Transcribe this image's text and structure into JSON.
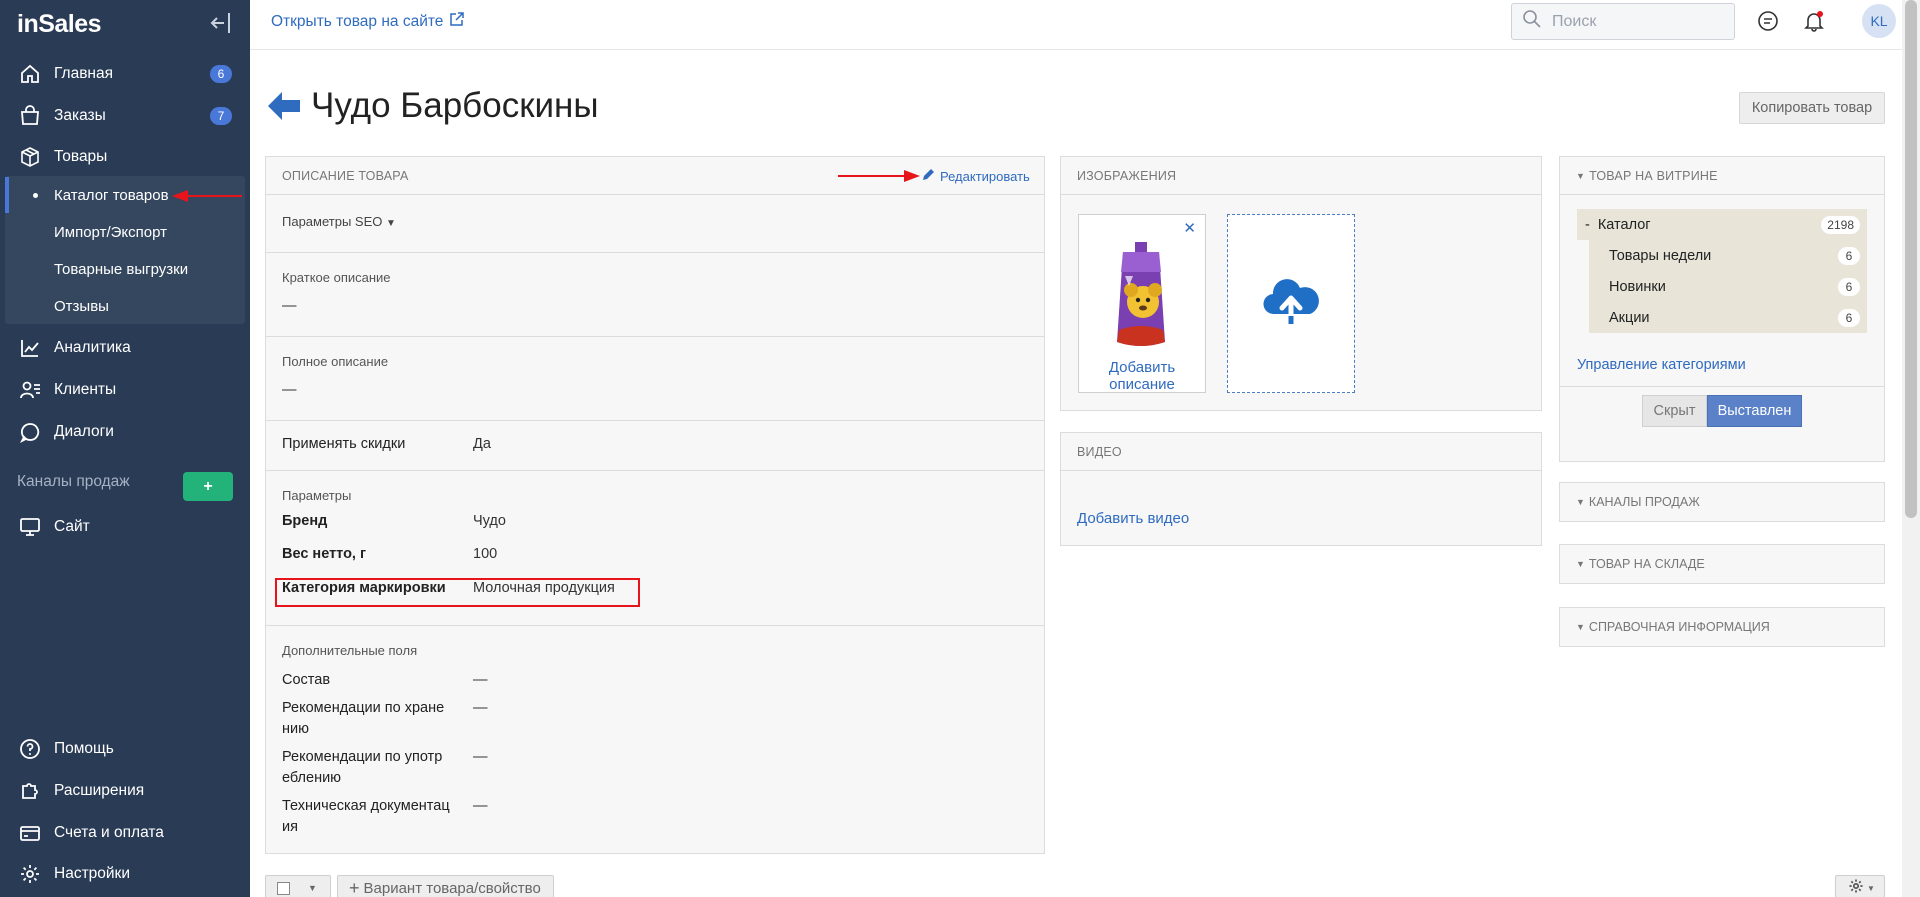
{
  "brand": {
    "logo_text": "inSales"
  },
  "sidebar": {
    "items": [
      {
        "label": "Главная",
        "badge": "6",
        "icon": "home-icon"
      },
      {
        "label": "Заказы",
        "badge": "7",
        "icon": "shopping-bag-icon"
      },
      {
        "label": "Товары",
        "icon": "box-icon"
      },
      {
        "label": "Аналитика",
        "icon": "chart-line-icon"
      },
      {
        "label": "Клиенты",
        "icon": "users-list-icon"
      },
      {
        "label": "Диалоги",
        "icon": "chat-icon"
      },
      {
        "label": "Сайт",
        "icon": "monitor-icon"
      },
      {
        "label": "Помощь",
        "icon": "help-circle-icon"
      },
      {
        "label": "Расширения",
        "icon": "puzzle-icon"
      },
      {
        "label": "Счета и оплата",
        "icon": "credit-card-icon"
      },
      {
        "label": "Настройки",
        "icon": "gear-icon"
      }
    ],
    "products_submenu": [
      "Каталог товаров",
      "Импорт/Экспорт",
      "Товарные выгрузки",
      "Отзывы"
    ],
    "channels_title": "Каналы продаж",
    "channels_add": "+"
  },
  "topbar": {
    "open_link": "Открыть товар на сайте",
    "search_placeholder": "Поиск",
    "avatar_initials": "KL"
  },
  "page": {
    "title": "Чудо Барбоскины",
    "copy_button": "Копировать товар"
  },
  "description_panel": {
    "title": "Описание товара",
    "edit_label": "Редактировать",
    "seo_label": "Параметры SEO",
    "short_desc_label": "Краткое описание",
    "short_desc_value": "—",
    "full_desc_label": "Полное описание",
    "full_desc_value": "—",
    "discount_label": "Применять скидки",
    "discount_value": "Да",
    "params_title": "Параметры",
    "params": [
      {
        "label": "Бренд",
        "value": "Чудо"
      },
      {
        "label": "Вес нетто, г",
        "value": "100"
      },
      {
        "label": "Категория маркировки",
        "value": "Молочная продукция"
      }
    ],
    "extra_title": "Дополнительные поля",
    "extra_fields": [
      {
        "label": "Состав",
        "value": "—"
      },
      {
        "label_line1": "Рекомендации по хране",
        "label_line2": "нию",
        "value": "—"
      },
      {
        "label_line1": "Рекомендации по употр",
        "label_line2": "еблению",
        "value": "—"
      },
      {
        "label_line1": "Техническая документац",
        "label_line2": "ия",
        "value": "—"
      }
    ]
  },
  "images_panel": {
    "title": "Изображения",
    "add_description_line1": "Добавить",
    "add_description_line2": "описание",
    "remove_symbol": "✕"
  },
  "video_panel": {
    "title": "Видео",
    "add_video": "Добавить видео"
  },
  "storefront_panel": {
    "title": "Товар на витрине",
    "catalog": {
      "label": "Каталог",
      "count": "2198",
      "toggle": "-"
    },
    "categories": [
      {
        "label": "Товары недели",
        "count": "6"
      },
      {
        "label": "Новинки",
        "count": "6"
      },
      {
        "label": "Акции",
        "count": "6"
      }
    ],
    "manage_link": "Управление категориями",
    "hidden_button": "Скрыт",
    "shown_button": "Выставлен"
  },
  "collapsed_panels": [
    "Каналы продаж",
    "Товар на складе",
    "Справочная информация"
  ],
  "bottom_toolbar": {
    "variant_button": "Вариант товара/свойство"
  },
  "colors": {
    "sidebar_bg": "#2a3b55",
    "accent_blue": "#2f6bbf",
    "badge_blue": "#4a78d9",
    "annotation_red": "#e8141c",
    "add_green": "#23b27a"
  }
}
